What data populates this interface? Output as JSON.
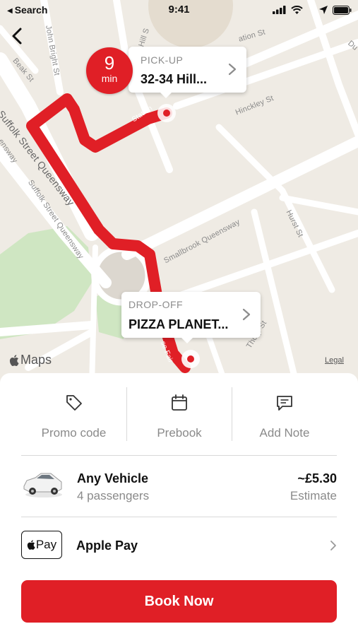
{
  "status_bar": {
    "back_label": "Search",
    "time": "9:41",
    "icons": [
      "signal-icon",
      "wifi-icon",
      "location-arrow-icon",
      "battery-icon"
    ]
  },
  "map": {
    "back_icon": "chevron-left-icon",
    "road_labels": {
      "station_st": "ation St",
      "hill_st": "Hill S",
      "john_bright_st": "John Bright St",
      "beak_st": "Beak St",
      "suffolk_queensway": "Suffolk Street Queensway",
      "suffolk_queensway_2": "Suffolk Street Queensway",
      "hinckley_st": "Hinckley St",
      "smallbrook_queensway": "Smallbrook Queensway",
      "hurst_st": "Hurst St",
      "thorp_st": "Thorp St",
      "station_route": "Station",
      "fair_route": "se Fair",
      "left_edge": "ensway",
      "top_right": "Du"
    },
    "pickup": {
      "eta_number": "9",
      "eta_unit": "min",
      "label": "PICK-UP",
      "address": "32-34 Hill..."
    },
    "dropoff": {
      "label": "DROP-OFF",
      "address": "PIZZA PLANET..."
    },
    "attribution": "Maps",
    "legal": "Legal",
    "route_color": "#e01f26"
  },
  "actions": [
    {
      "label": "Promo code",
      "icon": "tag-icon"
    },
    {
      "label": "Prebook",
      "icon": "calendar-icon"
    },
    {
      "label": "Add Note",
      "icon": "note-icon"
    }
  ],
  "vehicle": {
    "name": "Any Vehicle",
    "capacity": "4 passengers",
    "price": "~£5.30",
    "price_note": "Estimate",
    "icon": "car-icon"
  },
  "payment": {
    "mark_text": "Pay",
    "method": "Apple Pay",
    "icon": "apple-pay-icon"
  },
  "book_button": "Book Now",
  "colors": {
    "accent": "#e01f26",
    "secondary_text": "#8a8a8a",
    "divider": "#d9d9d9"
  }
}
